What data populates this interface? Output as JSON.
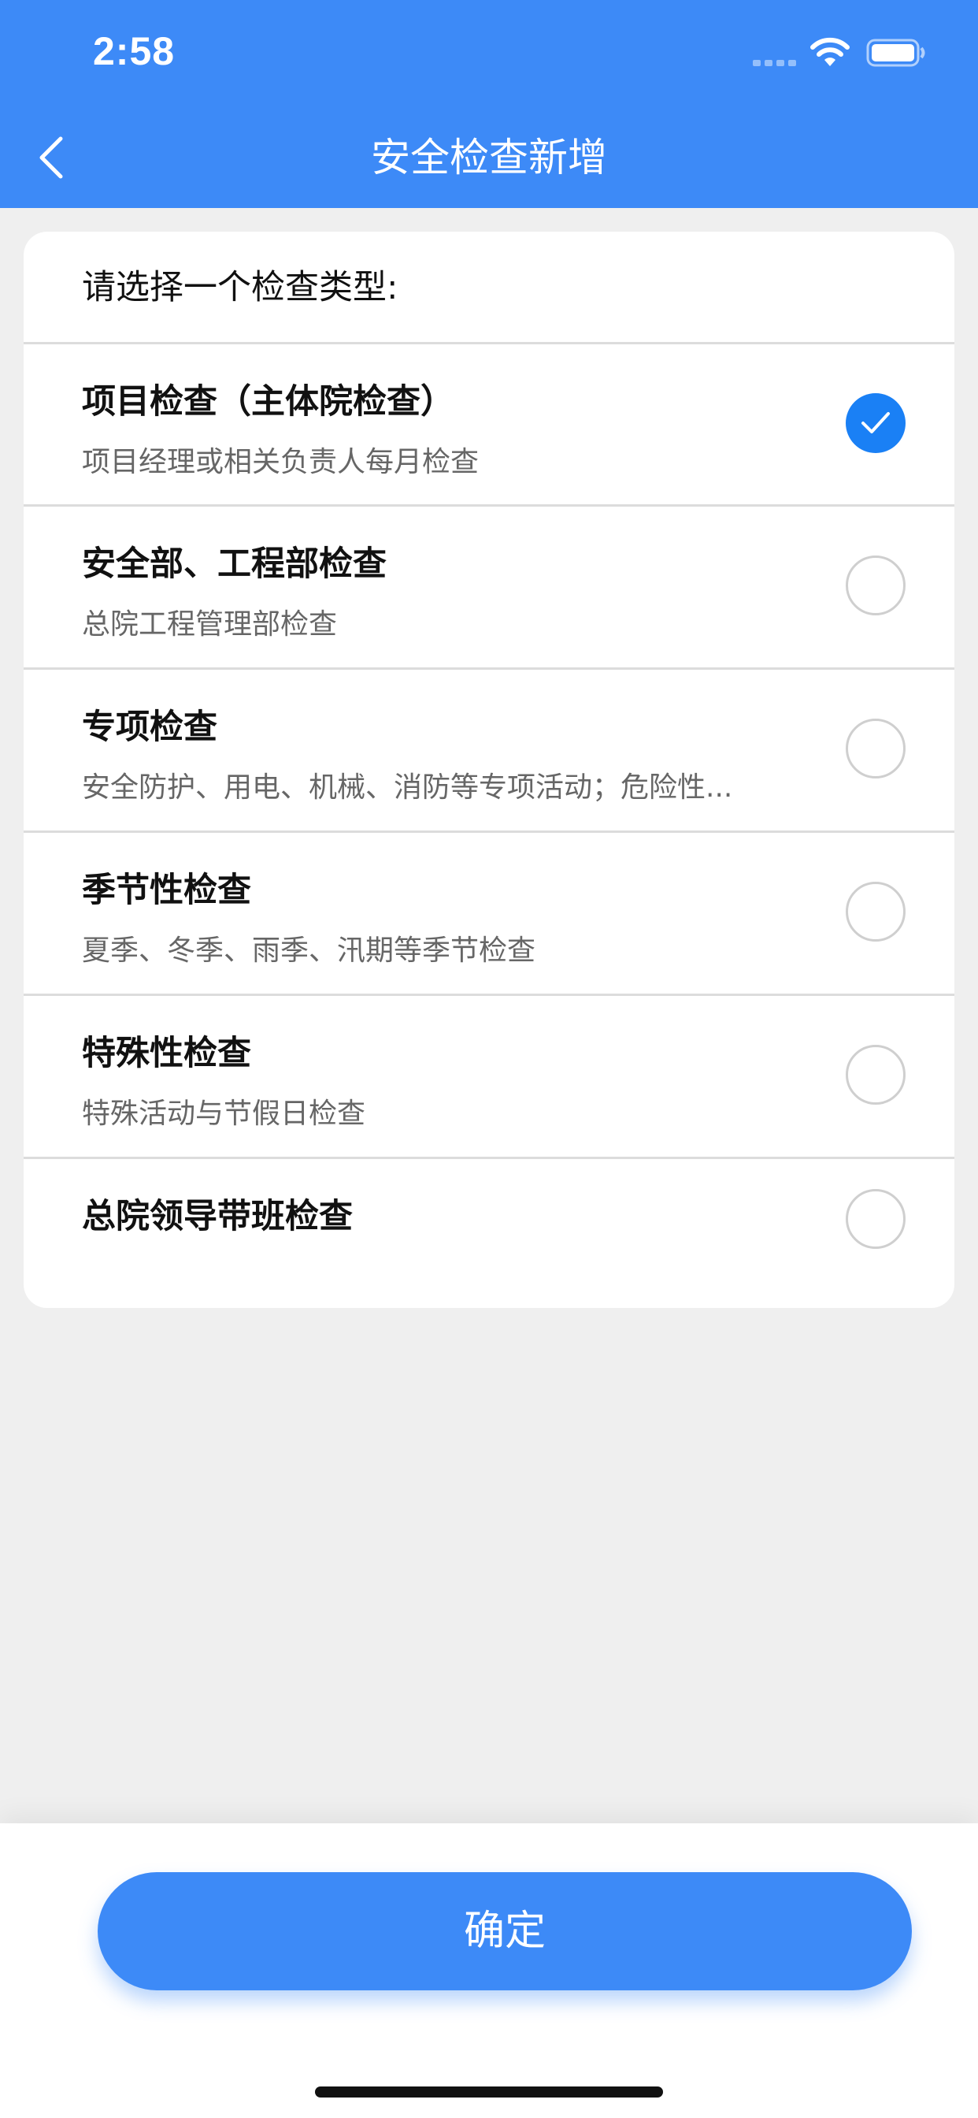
{
  "status_bar": {
    "time": "2:58"
  },
  "nav": {
    "title": "安全检查新增"
  },
  "prompt": "请选择一个检查类型:",
  "options": [
    {
      "title": "项目检查（主体院检查）",
      "description": "项目经理或相关负责人每月检查",
      "selected": true
    },
    {
      "title": "安全部、工程部检查",
      "description": "总院工程管理部检查",
      "selected": false
    },
    {
      "title": "专项检查",
      "description": "安全防护、用电、机械、消防等专项活动；危险性...",
      "selected": false
    },
    {
      "title": "季节性检查",
      "description": "夏季、冬季、雨季、汛期等季节检查",
      "selected": false
    },
    {
      "title": "特殊性检查",
      "description": "特殊活动与节假日检查",
      "selected": false
    },
    {
      "title": "总院领导带班检查",
      "description": "",
      "selected": false
    }
  ],
  "confirm_label": "确定",
  "colors": {
    "primary": "#3d8af7",
    "radio_checked": "#1a80f5",
    "background": "#efefef"
  }
}
